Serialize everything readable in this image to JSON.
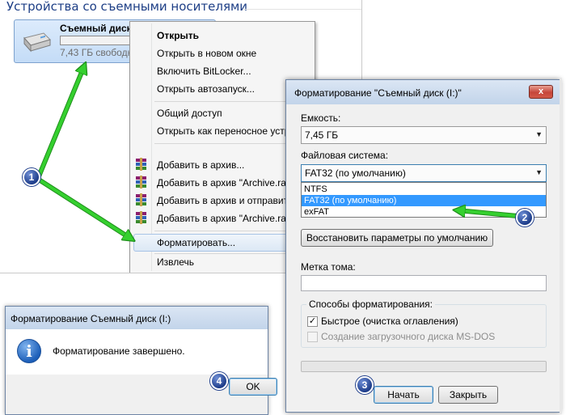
{
  "explorer": {
    "group_title": "Устройства со съемными носителями",
    "drive": {
      "name": "Съемный диск",
      "free": "7,43 ГБ свободн",
      "icon": "removable-drive-icon"
    }
  },
  "context_menu": {
    "items": [
      {
        "label": "Открыть",
        "bold": true
      },
      {
        "label": "Открыть в новом окне"
      },
      {
        "label": "Включить BitLocker..."
      },
      {
        "label": "Открыть автозапуск..."
      },
      {
        "label": "Общий доступ"
      },
      {
        "label": "Открыть как переносное устр"
      },
      {
        "label": "Добавить в архив..."
      },
      {
        "label": "Добавить в архив \"Archive.rar"
      },
      {
        "label": "Добавить в архив и отправит"
      },
      {
        "label": "Добавить в архив \"Archive.rar"
      },
      {
        "label": "Форматировать..."
      },
      {
        "label": "Извлечь"
      }
    ]
  },
  "format_dialog": {
    "title": "Форматирование \"Съемный диск (I:)\"",
    "close": "x",
    "capacity_label": "Емкость:",
    "capacity_value": "7,45 ГБ",
    "filesystem_label": "Файловая система:",
    "filesystem_value": "FAT32 (по умолчанию)",
    "filesystem_options": [
      "NTFS",
      "FAT32 (по умолчанию)",
      "exFAT"
    ],
    "selected_option_index": 1,
    "restore_defaults_button": "Восстановить параметры по умолчанию",
    "volume_label_label": "Метка тома:",
    "volume_label_value": "",
    "format_options_group": "Способы форматирования:",
    "quick_format_label": "Быстрое (очистка оглавления)",
    "quick_format_checked": true,
    "msdos_label": "Создание загрузочного диска MS-DOS",
    "msdos_checked": false,
    "progress": 0,
    "start_button": "Начать",
    "close_button": "Закрыть"
  },
  "info_dialog": {
    "title": "Форматирование Съемный диск (I:)",
    "message": "Форматирование завершено.",
    "ok_button": "OK",
    "icon": "info-icon"
  },
  "badges": [
    "1",
    "2",
    "3",
    "4"
  ],
  "colors": {
    "arrow_green": "#35d02f",
    "badge_blue": "#1e3d8a",
    "selection_blue": "#3399ff",
    "title_blue": "#1e3f86"
  }
}
